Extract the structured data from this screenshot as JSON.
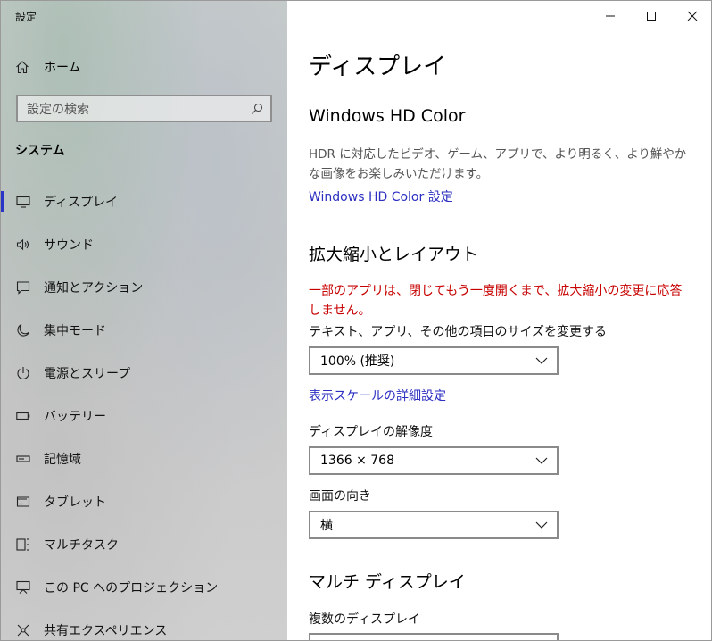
{
  "window": {
    "title": "設定"
  },
  "sidebar": {
    "home_label": "ホーム",
    "search_placeholder": "設定の検索",
    "section_label": "システム",
    "items": [
      {
        "label": "ディスプレイ",
        "icon": "monitor-icon",
        "selected": true
      },
      {
        "label": "サウンド",
        "icon": "speaker-icon"
      },
      {
        "label": "通知とアクション",
        "icon": "notification-icon"
      },
      {
        "label": "集中モード",
        "icon": "moon-icon"
      },
      {
        "label": "電源とスリープ",
        "icon": "power-icon"
      },
      {
        "label": "バッテリー",
        "icon": "battery-icon"
      },
      {
        "label": "記憶域",
        "icon": "storage-icon"
      },
      {
        "label": "タブレット",
        "icon": "tablet-icon"
      },
      {
        "label": "マルチタスク",
        "icon": "multitask-icon"
      },
      {
        "label": "この PC へのプロジェクション",
        "icon": "projection-icon"
      },
      {
        "label": "共有エクスペリエンス",
        "icon": "shared-experience-icon"
      }
    ]
  },
  "content": {
    "title": "ディスプレイ",
    "hdr": {
      "heading": "Windows HD Color",
      "description": "HDR に対応したビデオ、ゲーム、アプリで、より明るく、より鮮やかな画像をお楽しみいただけます。",
      "link": "Windows HD Color 設定"
    },
    "scale": {
      "heading": "拡大縮小とレイアウト",
      "warning": "一部のアプリは、閉じてもう一度開くまで、拡大縮小の変更に応答しません。",
      "size_label": "テキスト、アプリ、その他の項目のサイズを変更する",
      "size_value": "100% (推奨)",
      "advanced_link": "表示スケールの詳細設定",
      "resolution_label": "ディスプレイの解像度",
      "resolution_value": "1366 × 768",
      "orientation_label": "画面の向き",
      "orientation_value": "横"
    },
    "multi": {
      "heading": "マルチ ディスプレイ",
      "label": "複数のディスプレイ"
    }
  },
  "colors": {
    "accent": "#2a34c8",
    "link": "#2b2ec0",
    "warning": "#c70000"
  }
}
